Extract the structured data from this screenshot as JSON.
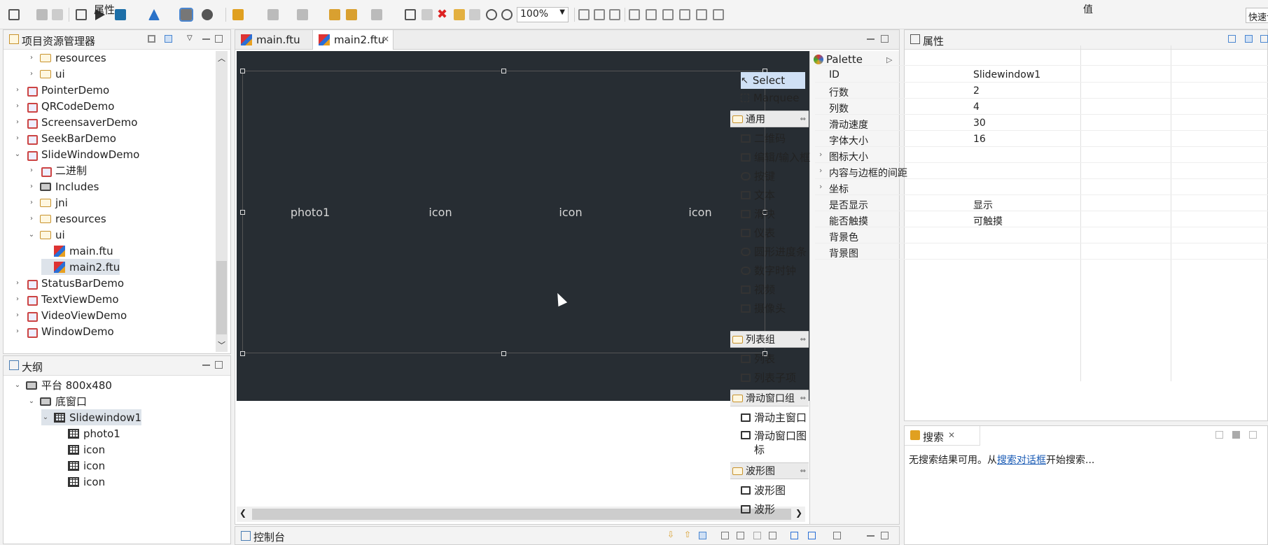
{
  "toolbar": {
    "zoom": "100%",
    "quick_access": "快速访问"
  },
  "project_explorer": {
    "title": "项目资源管理器",
    "items": [
      {
        "label": "resources",
        "indent": 1,
        "type": "folder"
      },
      {
        "label": "ui",
        "indent": 1,
        "type": "folder"
      },
      {
        "label": "PointerDemo",
        "indent": 0,
        "type": "project"
      },
      {
        "label": "QRCodeDemo",
        "indent": 0,
        "type": "project"
      },
      {
        "label": "ScreensaverDemo",
        "indent": 0,
        "type": "project"
      },
      {
        "label": "SeekBarDemo",
        "indent": 0,
        "type": "project"
      },
      {
        "label": "SlideWindowDemo",
        "indent": 0,
        "type": "project",
        "expanded": true
      },
      {
        "label": "二进制",
        "indent": 1,
        "type": "binary"
      },
      {
        "label": "Includes",
        "indent": 1,
        "type": "includes"
      },
      {
        "label": "jni",
        "indent": 1,
        "type": "folder"
      },
      {
        "label": "resources",
        "indent": 1,
        "type": "folder"
      },
      {
        "label": "ui",
        "indent": 1,
        "type": "folder",
        "expanded": true
      },
      {
        "label": "main.ftu",
        "indent": 2,
        "type": "file"
      },
      {
        "label": "main2.ftu",
        "indent": 2,
        "type": "file",
        "selected": true
      },
      {
        "label": "StatusBarDemo",
        "indent": 0,
        "type": "project"
      },
      {
        "label": "TextViewDemo",
        "indent": 0,
        "type": "project"
      },
      {
        "label": "VideoViewDemo",
        "indent": 0,
        "type": "project"
      },
      {
        "label": "WindowDemo",
        "indent": 0,
        "type": "project"
      }
    ]
  },
  "outline": {
    "title": "大纲",
    "items": [
      {
        "label": "平台 800x480",
        "indent": 0,
        "expanded": true
      },
      {
        "label": "底窗口",
        "indent": 1,
        "expanded": true
      },
      {
        "label": "Slidewindow1",
        "indent": 2,
        "expanded": true,
        "selected": true
      },
      {
        "label": "photo1",
        "indent": 3
      },
      {
        "label": "icon",
        "indent": 3
      },
      {
        "label": "icon",
        "indent": 3
      },
      {
        "label": "icon",
        "indent": 3
      }
    ]
  },
  "editor": {
    "tabs": [
      {
        "label": "main.ftu",
        "active": false
      },
      {
        "label": "main2.ftu",
        "active": true
      }
    ],
    "canvas_items": [
      "photo1",
      "icon",
      "icon",
      "icon"
    ]
  },
  "palette": {
    "title": "Palette",
    "tools": [
      "Select",
      "Marquee"
    ],
    "groups": [
      {
        "name": "通用",
        "items": [
          "二维码",
          "编辑/输入框",
          "按键",
          "文本",
          "滑块",
          "仪表",
          "圆形进度条",
          "数字时钟",
          "视频",
          "摄像头",
          "窗口"
        ]
      },
      {
        "name": "列表组",
        "items": [
          "列表",
          "列表子项"
        ]
      },
      {
        "name": "滑动窗口组",
        "items": [
          "滑动主窗口",
          "滑动窗口图标"
        ]
      },
      {
        "name": "波形图",
        "items": [
          "波形图",
          "波形"
        ]
      }
    ]
  },
  "properties": {
    "title": "属性",
    "header": {
      "key": "属性",
      "value": "值"
    },
    "rows": [
      {
        "key": "ID",
        "value": "Slidewindow1"
      },
      {
        "key": "行数",
        "value": "2"
      },
      {
        "key": "列数",
        "value": "4"
      },
      {
        "key": "滑动速度",
        "value": "30"
      },
      {
        "key": "字体大小",
        "value": "16"
      },
      {
        "key": "图标大小",
        "value": "",
        "expandable": true
      },
      {
        "key": "内容与边框的间距",
        "value": "",
        "expandable": true
      },
      {
        "key": "坐标",
        "value": "",
        "expandable": true
      },
      {
        "key": "是否显示",
        "value": "显示"
      },
      {
        "key": "能否触摸",
        "value": "可触摸"
      },
      {
        "key": "背景色",
        "value": ""
      },
      {
        "key": "背景图",
        "value": ""
      }
    ]
  },
  "search": {
    "title": "搜索",
    "message_prefix": "无搜索结果可用。从",
    "message_link": "搜索对话框",
    "message_suffix": "开始搜索..."
  },
  "console": {
    "title": "控制台"
  }
}
